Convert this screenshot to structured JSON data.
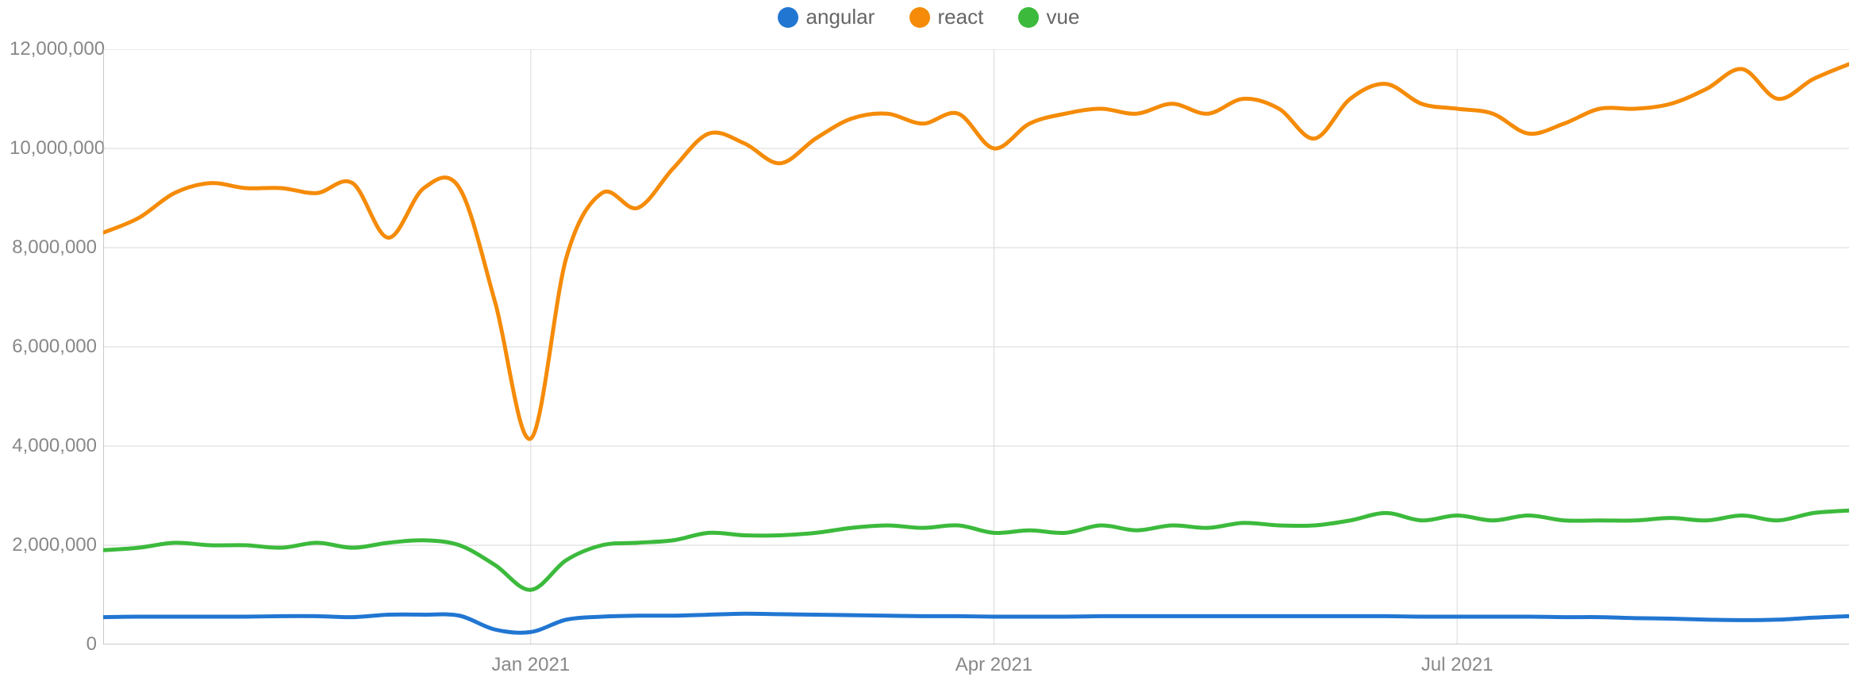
{
  "chart_data": {
    "type": "line",
    "title": "",
    "xlabel": "",
    "ylabel": "",
    "ylim": [
      0,
      12000000
    ],
    "y_ticks": [
      0,
      2000000,
      4000000,
      6000000,
      8000000,
      10000000,
      12000000
    ],
    "y_tick_labels": [
      "0",
      "2,000,000",
      "4,000,000",
      "6,000,000",
      "8,000,000",
      "10,000,000",
      "12,000,000"
    ],
    "x_ticks": [
      "Jan 2021",
      "Apr 2021",
      "Jul 2021"
    ],
    "x_tick_positions": [
      12,
      25,
      38
    ],
    "x_range_samples": 50,
    "legend": [
      {
        "name": "angular",
        "color": "#2176d2"
      },
      {
        "name": "react",
        "color": "#f58b08"
      },
      {
        "name": "vue",
        "color": "#3cba3c"
      }
    ],
    "series": [
      {
        "name": "angular",
        "color": "#2176d2",
        "values": [
          550000,
          560000,
          560000,
          560000,
          560000,
          570000,
          570000,
          550000,
          600000,
          600000,
          580000,
          300000,
          250000,
          500000,
          560000,
          580000,
          580000,
          600000,
          620000,
          610000,
          600000,
          590000,
          580000,
          570000,
          570000,
          560000,
          560000,
          560000,
          570000,
          570000,
          570000,
          570000,
          570000,
          570000,
          570000,
          570000,
          570000,
          560000,
          560000,
          560000,
          560000,
          550000,
          550000,
          530000,
          520000,
          500000,
          490000,
          500000,
          540000,
          570000
        ]
      },
      {
        "name": "react",
        "color": "#f58b08",
        "values": [
          8300000,
          8600000,
          9100000,
          9300000,
          9200000,
          9200000,
          9100000,
          9300000,
          8200000,
          9200000,
          9200000,
          6900000,
          4150000,
          7800000,
          9100000,
          8800000,
          9600000,
          10300000,
          10100000,
          9700000,
          10200000,
          10600000,
          10700000,
          10500000,
          10700000,
          10000000,
          10500000,
          10700000,
          10800000,
          10700000,
          10900000,
          10700000,
          11000000,
          10800000,
          10200000,
          11000000,
          11300000,
          10900000,
          10800000,
          10700000,
          10300000,
          10500000,
          10800000,
          10800000,
          10900000,
          11200000,
          11600000,
          11000000,
          11400000,
          11700000
        ]
      },
      {
        "name": "vue",
        "color": "#3cba3c",
        "values": [
          1900000,
          1950000,
          2050000,
          2000000,
          2000000,
          1950000,
          2050000,
          1950000,
          2050000,
          2100000,
          2000000,
          1600000,
          1100000,
          1700000,
          2000000,
          2050000,
          2100000,
          2250000,
          2200000,
          2200000,
          2250000,
          2350000,
          2400000,
          2350000,
          2400000,
          2250000,
          2300000,
          2250000,
          2400000,
          2300000,
          2400000,
          2350000,
          2450000,
          2400000,
          2400000,
          2500000,
          2650000,
          2500000,
          2600000,
          2500000,
          2600000,
          2500000,
          2500000,
          2500000,
          2550000,
          2500000,
          2600000,
          2500000,
          2650000,
          2700000
        ]
      }
    ]
  }
}
